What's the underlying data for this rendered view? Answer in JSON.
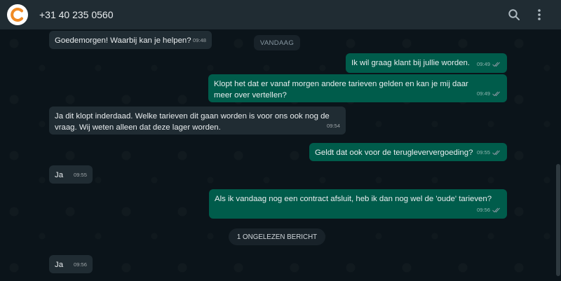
{
  "header": {
    "contact": "+31 40 235 0560",
    "icons": {
      "search": "search-icon",
      "menu": "more-vertical-icon",
      "avatar": "logo-c-orange"
    }
  },
  "colors": {
    "background": "#0b141a",
    "header": "#202c33",
    "incoming_bubble": "#202c33",
    "outgoing_bubble": "#005c4b",
    "brand_orange": "#f08a24",
    "tick": "#8696a0"
  },
  "day_divider": "VANDAAG",
  "unread_divider": "1 ONGELEZEN BERICHT",
  "messages": [
    {
      "dir": "in",
      "text": "Goedemorgen! Waarbij kan je helpen?",
      "time": "09:48"
    },
    {
      "dir": "out",
      "text": "Ik wil graag klant bij jullie worden.",
      "time": "09:49"
    },
    {
      "dir": "out",
      "text": "Klopt het dat er vanaf morgen andere tarieven gelden en kan je mij daar meer over vertellen?",
      "time": "09:49"
    },
    {
      "dir": "in",
      "text": "Ja dit klopt inderdaad. Welke tarieven dit gaan worden is voor ons ook nog de vraag. Wij weten alleen dat deze lager worden.",
      "time": "09:54"
    },
    {
      "dir": "out",
      "text": "Geldt dat ook voor de terugleververgoeding?",
      "time": "09:55"
    },
    {
      "dir": "in",
      "text": "Ja",
      "time": "09:55"
    },
    {
      "dir": "out",
      "text": "Als ik vandaag nog een contract afsluit, heb ik dan nog wel de 'oude' tarieven?",
      "time": "09:56"
    },
    {
      "dir": "in",
      "text": "Ja",
      "time": "09:56"
    }
  ]
}
